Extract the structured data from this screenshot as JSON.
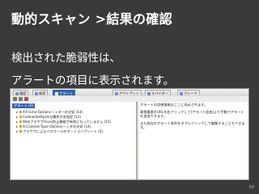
{
  "slide": {
    "title": "動的スキャン >結果の確認",
    "line1": "検出された脆弱性は、",
    "line2": "アラートの項目に表示されます。",
    "page_number": "69"
  },
  "tabs": [
    {
      "label": "履歴",
      "active": false
    },
    {
      "label": "検索",
      "active": false
    },
    {
      "label": "アラート",
      "active": true
    },
    {
      "label": "アウトプット",
      "active": false
    },
    {
      "label": "スパイダー",
      "active": false
    },
    {
      "label": "ブレーク",
      "active": false
    }
  ],
  "tree": {
    "root": "アラート (6)",
    "items": [
      {
        "label": "X-Frame-Optionsヘッダーの欠如 (14)",
        "color": "#e0a000"
      },
      {
        "label": "Cookie内HttpOnly属性が未指定 (12)",
        "color": "#e0a000"
      },
      {
        "label": "Webブラウザのxss防止機能が有効になっていません (15)",
        "color": "#e0a000"
      },
      {
        "label": "X-Content-Type-Optionsヘッダの欠如 (14)",
        "color": "#e0a000"
      },
      {
        "label": "ブラウザによるパスワードのオートコンプリート (5)",
        "color": "#e0a000"
      }
    ]
  },
  "details": {
    "p1": "アラートの詳細情報はここに表示されます。",
    "p2": "喫食履歴のURLを右クリックして[アラート追加]より手動でアラートを追加できます。",
    "p3": "また既存のアラート条件をダブルクリックして編集することもできます。"
  },
  "colors": {
    "background": "#3a3a3a",
    "tab_active": "#2f66b0",
    "tree_selected": "#3a66b8"
  }
}
